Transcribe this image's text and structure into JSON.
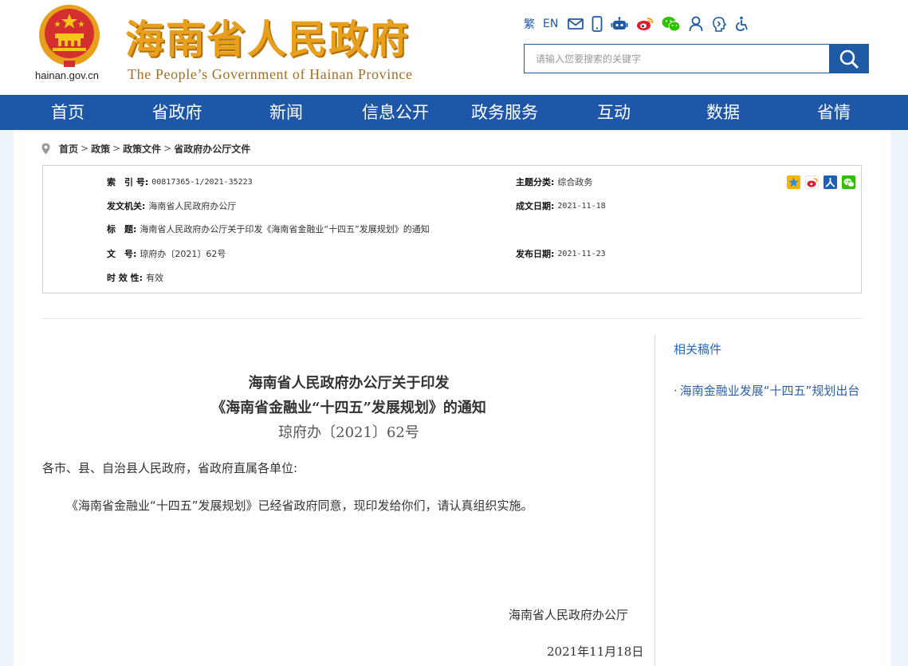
{
  "header": {
    "domain": "hainan.gov.cn",
    "cn_title": "海南省人民政府",
    "en_title": "The People’s Government  of Hainan Province",
    "tools": {
      "traditional": "繁",
      "english": "EN"
    },
    "search": {
      "placeholder": "请输入您要搜索的关键字"
    }
  },
  "nav": {
    "items": [
      "首页",
      "省政府",
      "新闻",
      "信息公开",
      "政务服务",
      "互动",
      "数据",
      "省情"
    ]
  },
  "breadcrumb": {
    "items": [
      "首页",
      "政策",
      "政策文件",
      "省政府办公厅文件"
    ],
    "separator": ">"
  },
  "meta": {
    "index_label": "索　引 号:",
    "index_value": "00817365-1/2021-35223",
    "category_label": "主题分类:",
    "category_value": "综合政务",
    "issuer_label": "发文机关:",
    "issuer_value": "海南省人民政府办公厅",
    "created_label": "成文日期:",
    "created_value": "2021-11-18",
    "title_label": "标　题:",
    "title_value": "海南省人民政府办公厅关于印发《海南省金融业“十四五”发展规划》的通知",
    "docno_label": "文　号:",
    "docno_value": "琼府办〔2021〕62号",
    "published_label": "发布日期:",
    "published_value": "2021-11-23",
    "validity_label": "时 效 性:",
    "validity_value": "有效"
  },
  "document": {
    "title_line1": "海南省人民政府办公厅关于印发",
    "title_line2": "《海南省金融业“十四五”发展规划》的通知",
    "doc_number": "琼府办〔2021〕62号",
    "salutation": "各市、县、自治县人民政府，省政府直属各单位:",
    "body": "《海南省金融业“十四五”发展规划》已经省政府同意，现印发给你们，请认真组织实施。",
    "signature": "海南省人民政府办公厅",
    "date": "2021年11月18日"
  },
  "related": {
    "title": "相关稿件",
    "items": [
      "海南金融业发展“十四五”规划出台"
    ]
  },
  "colors": {
    "nav_blue": "#1f57a8",
    "brand_gold": "#e8a01c",
    "link_blue": "#2f5fa8"
  }
}
